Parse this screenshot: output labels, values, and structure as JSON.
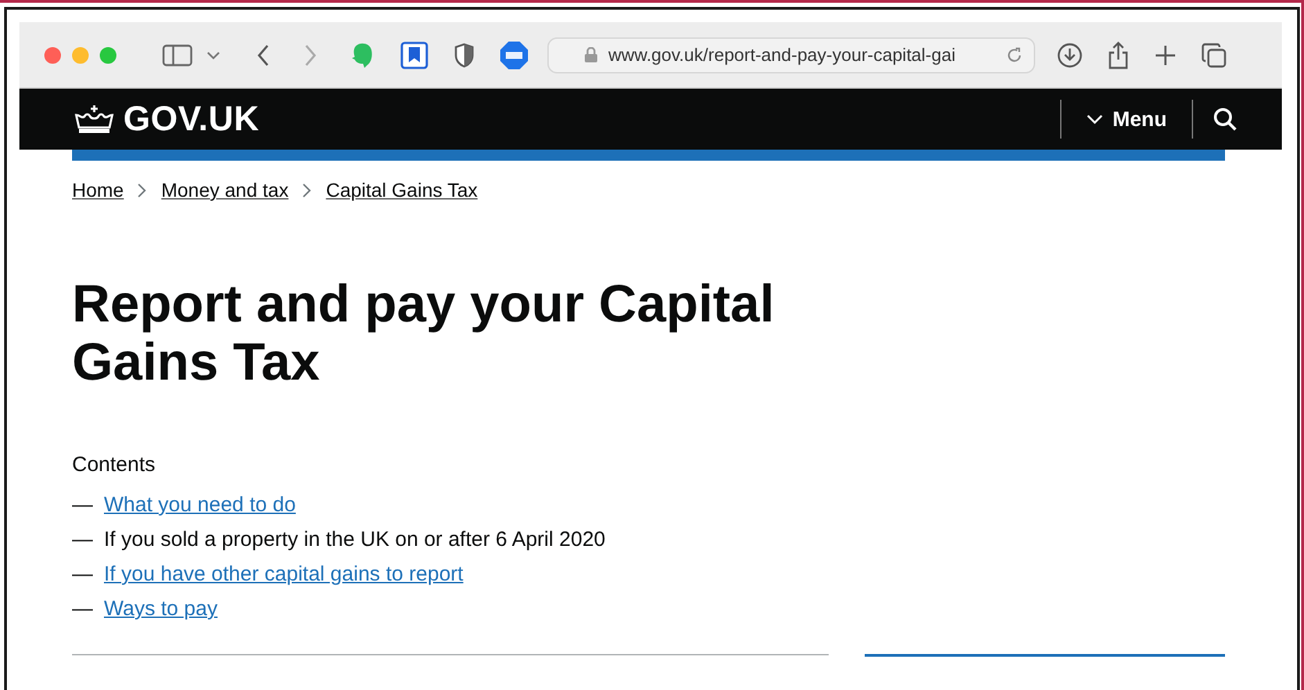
{
  "browser": {
    "url": "www.gov.uk/report-and-pay-your-capital-gai"
  },
  "header": {
    "logo": "GOV.UK",
    "menu": "Menu"
  },
  "breadcrumbs": [
    {
      "label": "Home"
    },
    {
      "label": "Money and tax"
    },
    {
      "label": "Capital Gains Tax"
    }
  ],
  "title": "Report and pay your Capital Gains Tax",
  "contents": {
    "heading": "Contents",
    "items": [
      {
        "dash": "—",
        "label": "What you need to do",
        "selected": false
      },
      {
        "dash": "—",
        "label": "If you sold a property in the UK on or after 6 April 2020",
        "selected": true
      },
      {
        "dash": "—",
        "label": "If you have other capital gains to report",
        "selected": false
      },
      {
        "dash": "—",
        "label": "Ways to pay",
        "selected": false
      }
    ]
  }
}
